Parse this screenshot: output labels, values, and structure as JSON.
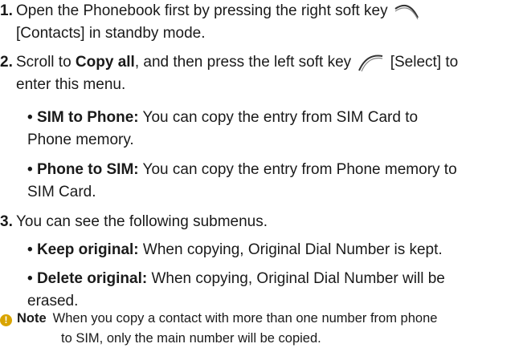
{
  "steps": [
    {
      "number": "1.",
      "text_a": "Open the Phonebook first by pressing the right soft key",
      "text_b": "[Contacts] in standby mode.",
      "softkey_icon": "right-soft-key-icon"
    },
    {
      "number": "2.",
      "text_a": "Scroll to ",
      "bold": "Copy all",
      "text_b": ", and then press the left soft key",
      "text_c": "[Select] to",
      "text_d": "enter this menu.",
      "softkey_icon": "left-soft-key-icon"
    },
    {
      "number": "3.",
      "text_a": "You can see the following submenus."
    }
  ],
  "copy_options": [
    {
      "bullet": "•",
      "label": "SIM to Phone:",
      "line1": "You can copy the entry from SIM Card to",
      "line2": "Phone memory."
    },
    {
      "bullet": "•",
      "label": "Phone to SIM:",
      "line1": "You can copy the entry from Phone memory to",
      "line2": "SIM Card."
    }
  ],
  "submenus": [
    {
      "bullet": "•",
      "label": "Keep original:",
      "line1": "When copying, Original Dial Number is kept."
    },
    {
      "bullet": "•",
      "label": "Delete original:",
      "line1": "When copying, Original Dial Number will be",
      "line2": "erased."
    }
  ],
  "note": {
    "icon_glyph": "!",
    "label": "Note",
    "line1": "When you copy a contact with more than one number from phone",
    "line2": "to SIM, only the main number will be copied.",
    "icon_color": "#d9a400"
  }
}
